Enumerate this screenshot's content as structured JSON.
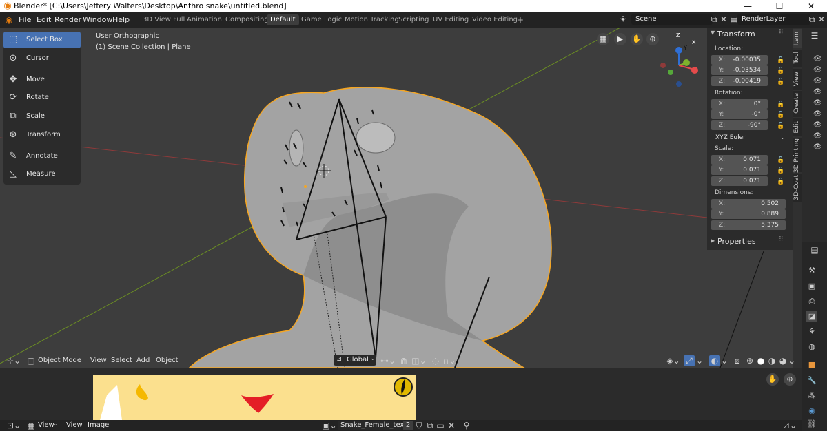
{
  "window": {
    "title": "Blender* [C:\\Users\\Jeffery Walters\\Desktop\\Anthro snake\\untitled.blend]",
    "minimize": "—",
    "maximize": "☐",
    "close": "✕"
  },
  "menus": [
    "File",
    "Edit",
    "Render",
    "Window",
    "Help"
  ],
  "workspace_tabs": [
    "3D View Full",
    "Animation",
    "Compositing",
    "Default",
    "Game Logic",
    "Motion Tracking",
    "Scripting",
    "UV Editing",
    "Video Editing"
  ],
  "active_tab": "Default",
  "add_tab": "+",
  "scene": {
    "name": "Scene",
    "render_layer": "RenderLayer"
  },
  "tools": [
    "Select Box",
    "Cursor",
    "Move",
    "Rotate",
    "Scale",
    "Transform",
    "Annotate",
    "Measure"
  ],
  "active_tool": "Select Box",
  "viewport": {
    "view_name": "User Orthographic",
    "collection": "(1) Scene Collection | Plane"
  },
  "gizmo": {
    "x": "X",
    "y": "Y",
    "z": "Z"
  },
  "transform_panel": {
    "title": "Transform",
    "location_label": "Location:",
    "location": {
      "x": "-0.00035",
      "y": "-0.03534",
      "z": "-0.00419"
    },
    "rotation_label": "Rotation:",
    "rotation": {
      "x": "0°",
      "y": "-0°",
      "z": "-90°"
    },
    "rotation_mode": "XYZ Euler",
    "scale_label": "Scale:",
    "scale": {
      "x": "0.071",
      "y": "0.071",
      "z": "0.071"
    },
    "dimensions_label": "Dimensions:",
    "dimensions": {
      "x": "0.502",
      "y": "0.889",
      "z": "5.375"
    },
    "axis_x": "X:",
    "axis_y": "Y:",
    "axis_z": "Z:"
  },
  "properties_panel": {
    "title": "Properties"
  },
  "side_tabs": [
    "Item",
    "Tool",
    "View",
    "Create",
    "Edit",
    "3D Printing",
    "3D-Coat"
  ],
  "viewport_header": {
    "mode": "Object Mode",
    "menus": [
      "View",
      "Select",
      "Add",
      "Object"
    ],
    "orientation": "Global"
  },
  "image_editor": {
    "menus": [
      "View",
      "View",
      "Image"
    ],
    "image_name": "Snake_Female_tex",
    "users": "2"
  },
  "colors": {
    "accent": "#4772b3",
    "selection": "#f5a623",
    "texture_bg": "#fbe08e",
    "mouth": "#e41e26"
  }
}
